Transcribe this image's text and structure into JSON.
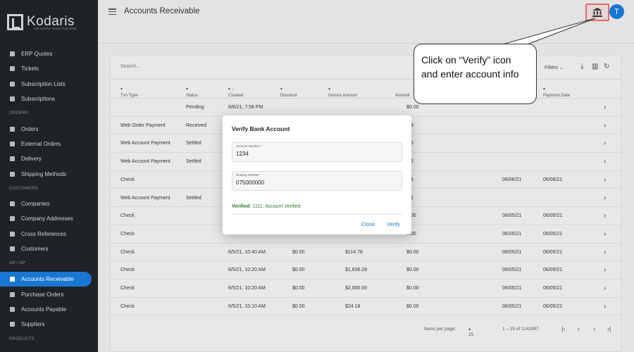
{
  "brand": {
    "name": "Kodaris",
    "tagline": "THE SUPPLY CHAIN PLATFORM"
  },
  "sidebar": {
    "items": [
      {
        "label": "ERP Quotes",
        "icon": "quote-icon"
      },
      {
        "label": "Tickets",
        "icon": "ticket-icon"
      },
      {
        "label": "Subscription Lists",
        "icon": "list-icon"
      },
      {
        "label": "Subscriptions",
        "icon": "subscription-icon"
      },
      {
        "label": "Orders",
        "icon": "truck-icon"
      },
      {
        "label": "External Orders",
        "icon": "arrow-icon"
      },
      {
        "label": "Delivery",
        "icon": "truck-icon"
      },
      {
        "label": "Shipping Methods",
        "icon": "truck-icon"
      },
      {
        "label": "Companies",
        "icon": "building-icon"
      },
      {
        "label": "Company Addresses",
        "icon": "pin-icon"
      },
      {
        "label": "Cross References",
        "icon": "swap-icon"
      },
      {
        "label": "Customers",
        "icon": "people-icon"
      },
      {
        "label": "Accounts Receivable",
        "icon": "card-icon"
      },
      {
        "label": "Purchase Orders",
        "icon": "po-icon"
      },
      {
        "label": "Accounts Payable",
        "icon": "payable-icon"
      },
      {
        "label": "Suppliers",
        "icon": "supplier-icon"
      }
    ],
    "sections": [
      "ORDERS",
      "CUSTOMERS",
      "AR / AP",
      "PRODUCTS"
    ]
  },
  "header": {
    "title": "Accounts Receivable",
    "avatar_initial": "T"
  },
  "toolbar": {
    "search_placeholder": "Search...",
    "filters_label": "Filters"
  },
  "table": {
    "columns": [
      "Txn Type",
      "Status",
      "Created",
      "Discount",
      "Invoice Amount",
      "Amount",
      "Payment Date"
    ],
    "rows": [
      {
        "type": "",
        "status": "Pending",
        "created": "6/6/21, 7:56 PM",
        "discount": "",
        "invoice": "",
        "amount": "$0.00",
        "d1": "",
        "d2": ""
      },
      {
        "type": "Web Order Payment",
        "status": "Received",
        "created": "",
        "discount": "",
        "invoice": "",
        "amount": ".39",
        "d1": "",
        "d2": ""
      },
      {
        "type": "Web Account Payment",
        "status": "Settled",
        "created": "",
        "discount": "",
        "invoice": "",
        "amount": ".25",
        "d1": "",
        "d2": ""
      },
      {
        "type": "Web Account Payment",
        "status": "Settled",
        "created": "",
        "discount": "",
        "invoice": "",
        "amount": ".32",
        "d1": "",
        "d2": ""
      },
      {
        "type": "Check",
        "status": "",
        "created": "",
        "discount": "",
        "invoice": "",
        "amount": ".08",
        "d1": "06/06/21",
        "d2": "06/06/21"
      },
      {
        "type": "Web Account Payment",
        "status": "Settled",
        "created": "",
        "discount": "",
        "invoice": "",
        "amount": ".92",
        "d1": "",
        "d2": ""
      },
      {
        "type": "Check",
        "status": "",
        "created": "",
        "discount": "",
        "invoice": "",
        "amount": "0.00",
        "d1": "06/05/21",
        "d2": "06/05/21"
      },
      {
        "type": "Check",
        "status": "",
        "created": "",
        "discount": "",
        "invoice": "",
        "amount": "0.00",
        "d1": "06/05/21",
        "d2": "06/05/21"
      },
      {
        "type": "Check",
        "status": "",
        "created": "6/5/21, 10:40 AM",
        "discount": "$0.00",
        "invoice": "$114.78",
        "amount": "$0.00",
        "d1": "06/05/21",
        "d2": "06/05/21"
      },
      {
        "type": "Check",
        "status": "",
        "created": "6/5/21, 10:20 AM",
        "discount": "$0.00",
        "invoice": "$1,836.28",
        "amount": "$0.00",
        "d1": "06/05/21",
        "d2": "06/05/21"
      },
      {
        "type": "Check",
        "status": "",
        "created": "6/5/21, 10:20 AM",
        "discount": "$0.00",
        "invoice": "$2,000.00",
        "amount": "$0.00",
        "d1": "06/05/21",
        "d2": "06/05/21"
      },
      {
        "type": "Check",
        "status": "",
        "created": "6/5/21, 10:10 AM",
        "discount": "$0.00",
        "invoice": "$24.18",
        "amount": "$0.00",
        "d1": "06/05/21",
        "d2": "06/05/21"
      }
    ]
  },
  "footer": {
    "items_per_page_label": "Items per page:",
    "items_per_page": "25",
    "range": "1 – 25 of 1142997"
  },
  "dialog": {
    "title": "Verify Bank Account",
    "account_label": "Account Number *",
    "account_value": "1234",
    "routing_label": "Routing Number *",
    "routing_value": "075000000",
    "verified_label": "Verified:",
    "verified_text": "1111: Account Verified",
    "close_label": "Close",
    "verify_label": "Verify"
  },
  "callout": {
    "text": "Click on “Verify” icon and enter account info"
  },
  "colors": {
    "accent": "#1976d2",
    "highlight": "#e06b6b",
    "verified": "#2e7d32"
  }
}
